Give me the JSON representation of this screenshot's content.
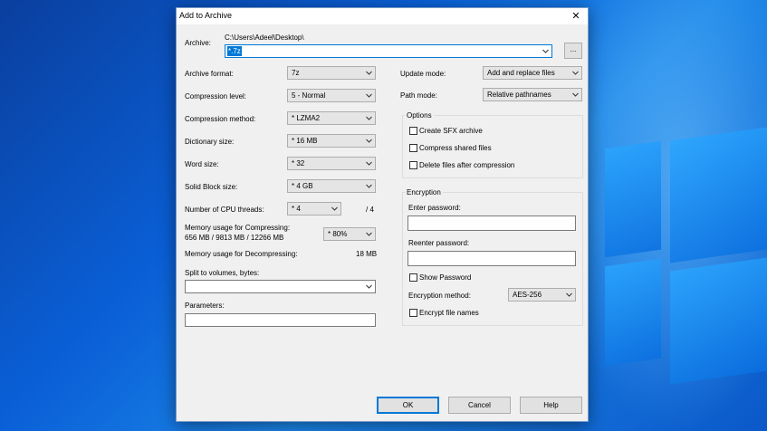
{
  "dialog": {
    "title": "Add to Archive",
    "close_glyph": "✕"
  },
  "archive": {
    "label": "Archive:",
    "path": "C:\\Users\\Adeel\\Desktop\\",
    "value": "*.7z",
    "browse_label": "..."
  },
  "left": {
    "archive_format_label": "Archive format:",
    "archive_format_value": "7z",
    "compression_level_label": "Compression level:",
    "compression_level_value": "5 - Normal",
    "compression_method_label": "Compression method:",
    "compression_method_value": "* LZMA2",
    "dictionary_size_label": "Dictionary size:",
    "dictionary_size_value": "* 16 MB",
    "word_size_label": "Word size:",
    "word_size_value": "* 32",
    "solid_block_label": "Solid Block size:",
    "solid_block_value": "* 4 GB",
    "cpu_threads_label": "Number of CPU threads:",
    "cpu_threads_value": "* 4",
    "cpu_threads_total": "/ 4",
    "mem_compress_label": "Memory usage for Compressing:",
    "mem_compress_value": "656 MB / 9813 MB / 12266 MB",
    "mem_compress_percent": "* 80%",
    "mem_decompress_label": "Memory usage for Decompressing:",
    "mem_decompress_value": "18 MB",
    "split_label": "Split to volumes, bytes:",
    "split_value": "",
    "parameters_label": "Parameters:",
    "parameters_value": ""
  },
  "right": {
    "update_mode_label": "Update mode:",
    "update_mode_value": "Add and replace files",
    "path_mode_label": "Path mode:",
    "path_mode_value": "Relative pathnames",
    "options_title": "Options",
    "opt_sfx": "Create SFX archive",
    "opt_shared": "Compress shared files",
    "opt_delete": "Delete files after compression",
    "encryption_title": "Encryption",
    "enter_password_label": "Enter password:",
    "reenter_password_label": "Reenter password:",
    "show_password": "Show Password",
    "encryption_method_label": "Encryption method:",
    "encryption_method_value": "AES-256",
    "encrypt_names": "Encrypt file names"
  },
  "buttons": {
    "ok": "OK",
    "cancel": "Cancel",
    "help": "Help"
  }
}
